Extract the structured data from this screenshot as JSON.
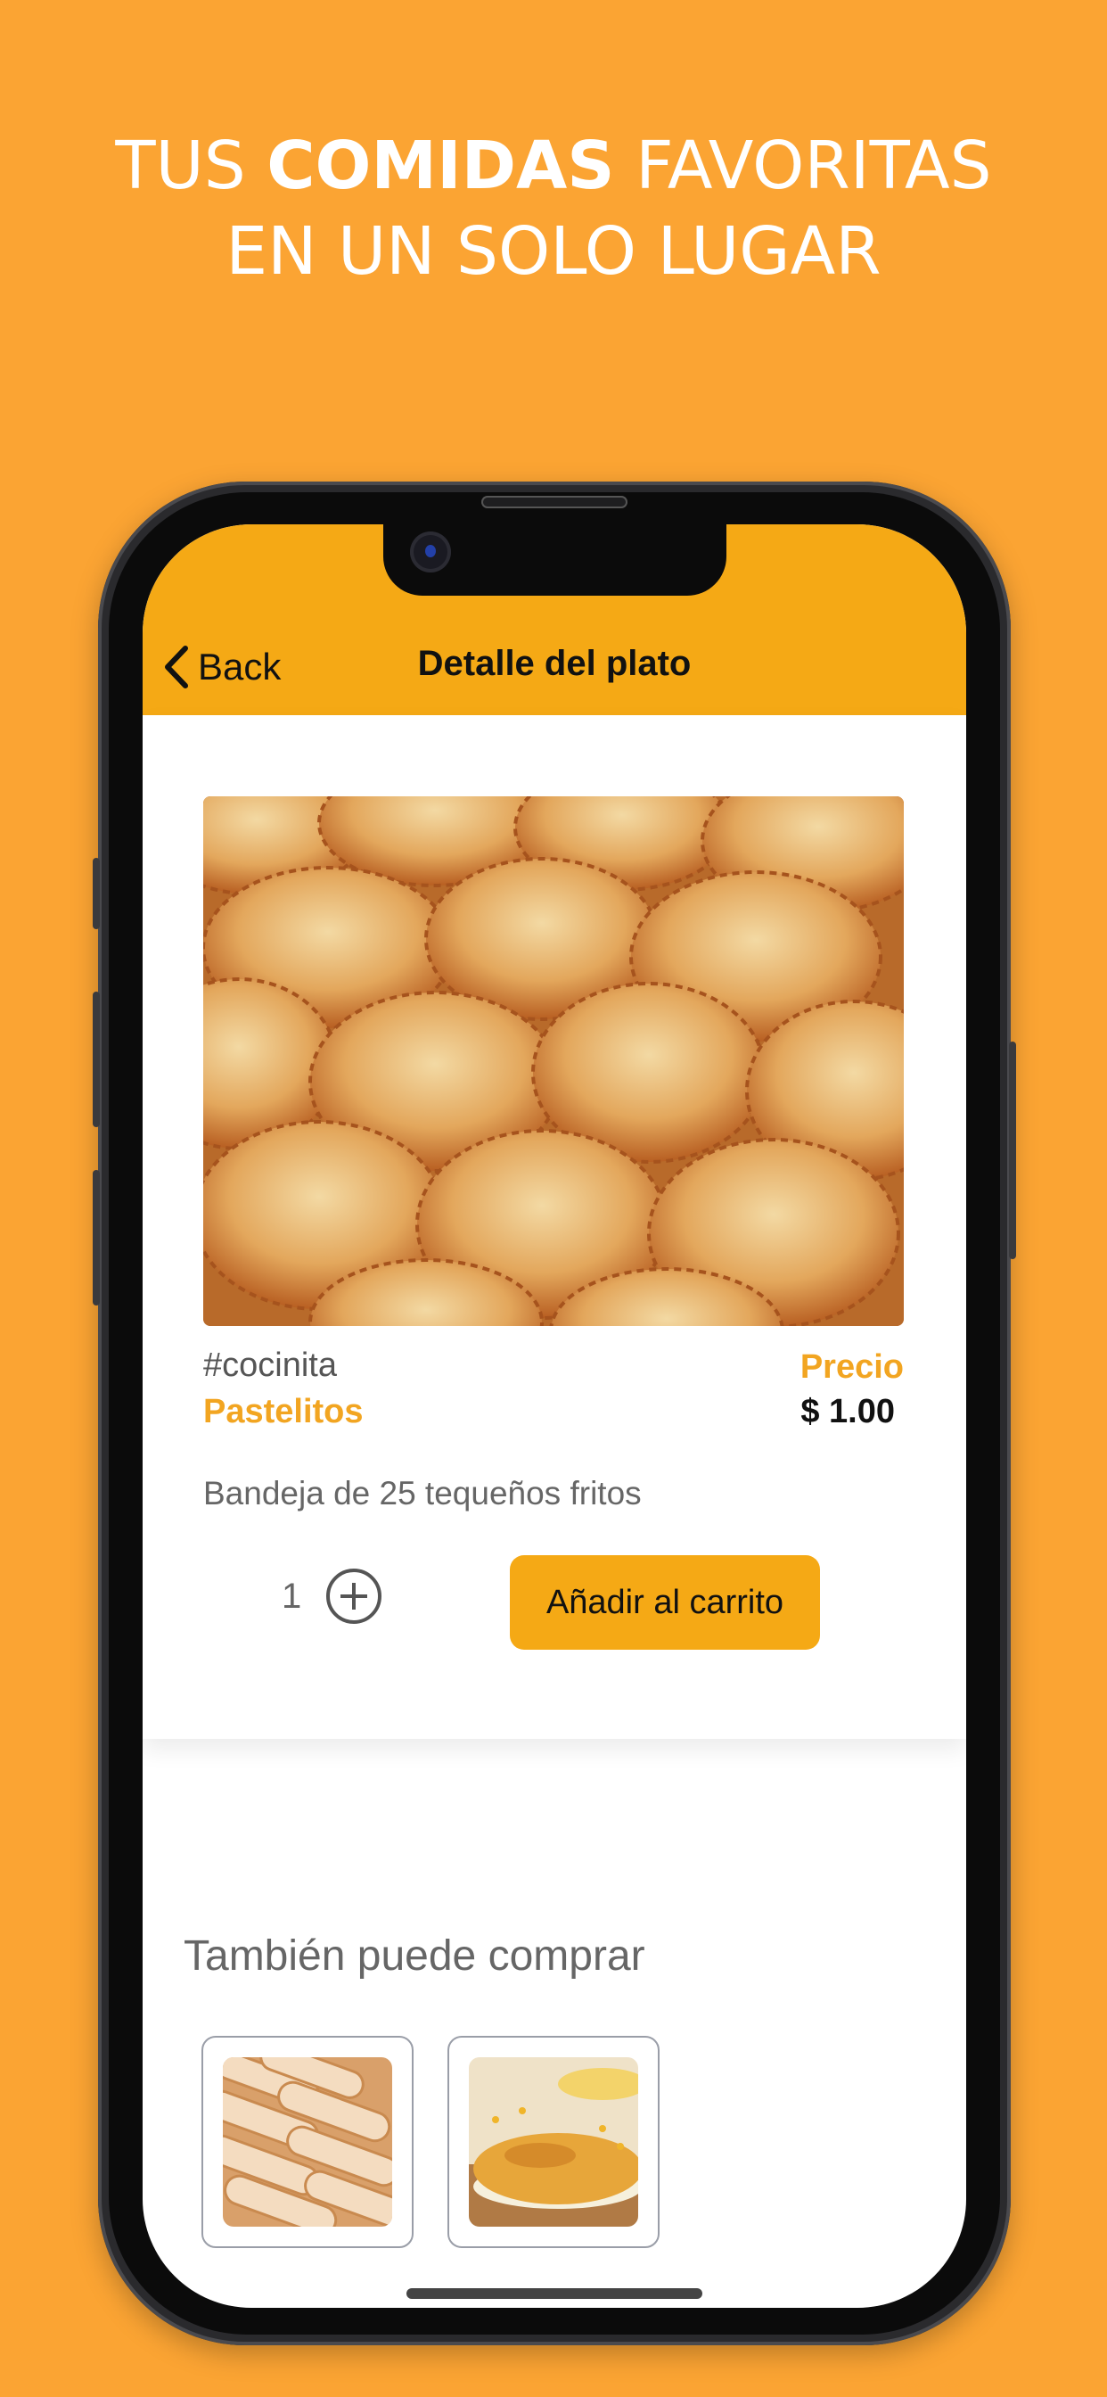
{
  "promo": {
    "line1_pre": "TUS ",
    "line1_bold": "COMIDAS",
    "line1_post": " FAVORITAS",
    "line2": "EN UN SOLO LUGAR"
  },
  "header": {
    "back_label": "Back",
    "title": "Detalle del plato"
  },
  "dish": {
    "tag": "#cocinita",
    "name": "Pastelitos",
    "price_label": "Precio",
    "price_value": "$ 1.00",
    "description": "Bandeja de 25 tequeños fritos",
    "quantity": "1",
    "add_to_cart_label": "Añadir al carrito"
  },
  "also_buy": {
    "title": "También puede comprar",
    "items": [
      {
        "image": "tequenos-photo"
      },
      {
        "image": "cachapa-photo"
      }
    ]
  },
  "colors": {
    "background": "#FBA433",
    "header": "#F5A915",
    "accent_text": "#F2A521"
  }
}
